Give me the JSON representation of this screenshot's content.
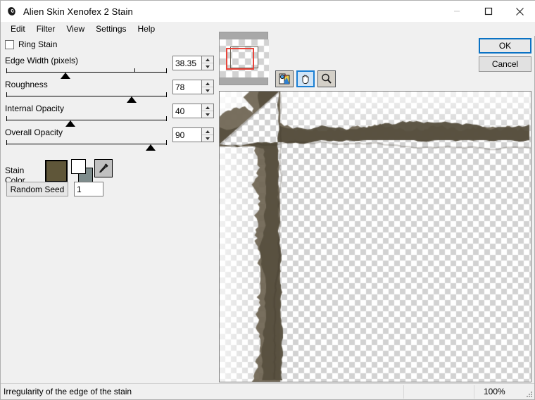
{
  "window": {
    "title": "Alien Skin Xenofex 2 Stain",
    "icon": "app-spiral-icon",
    "minimize": "minimize-icon",
    "maximize": "maximize-icon",
    "close": "close-icon"
  },
  "menubar": {
    "items": [
      {
        "label": "Edit"
      },
      {
        "label": "Filter"
      },
      {
        "label": "View"
      },
      {
        "label": "Settings"
      },
      {
        "label": "Help"
      }
    ]
  },
  "settings": {
    "ring_stain": {
      "label": "Ring Stain",
      "checked": false
    },
    "sliders": [
      {
        "label": "Edge Width (pixels)",
        "value": "38.35",
        "percent": 37,
        "tick_percent": 80
      },
      {
        "label": "Roughness",
        "value": "78",
        "percent": 78,
        "tick_percent": null
      },
      {
        "label": "Internal Opacity",
        "value": "40",
        "percent": 40,
        "tick_percent": null
      },
      {
        "label": "Overall Opacity",
        "value": "90",
        "percent": 90,
        "tick_percent": null
      }
    ],
    "stain_color": {
      "label": "Stain Color",
      "swatch_hex": "#5f5639",
      "foreground_hex": "#ffffff",
      "background_hex": "#7e8c8c",
      "eyedropper": "eyedropper-icon"
    },
    "random_seed": {
      "button_label": "Random Seed",
      "value": "1"
    }
  },
  "preview": {
    "navigator": {
      "selection_color": "#e8443a"
    },
    "tools": [
      {
        "name": "preview-toggle-icon",
        "selected": false
      },
      {
        "name": "hand-pan-icon",
        "selected": true
      },
      {
        "name": "zoom-magnifier-icon",
        "selected": false
      }
    ],
    "stain_color_hex": "#6d6350",
    "stain_dark_hex": "#57503f",
    "checker_light": "#ffffff",
    "checker_dark": "#d2d2d2"
  },
  "actions": {
    "ok_label": "OK",
    "cancel_label": "Cancel"
  },
  "statusbar": {
    "message": "Irregularity of the edge of the stain",
    "zoom": "100%"
  }
}
